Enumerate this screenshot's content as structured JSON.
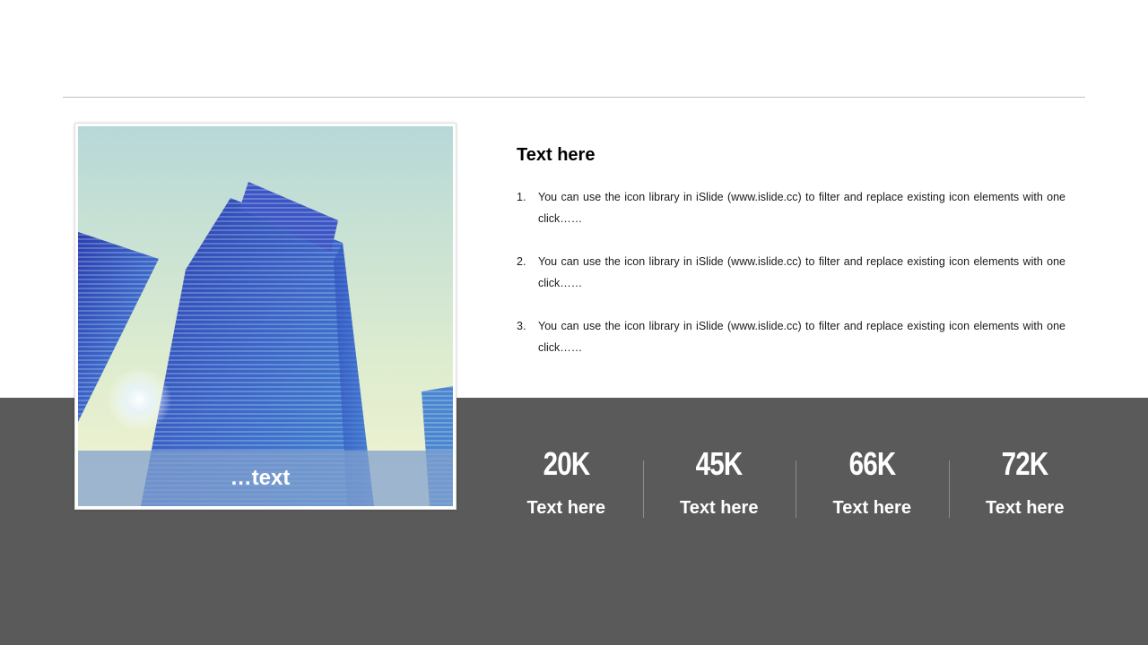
{
  "photo": {
    "caption": "…text"
  },
  "content": {
    "title": "Text here",
    "items": [
      {
        "number": "1.",
        "text": "You can use the icon library in iSlide  (www.islide.cc) to filter and replace existing icon elements with one click……"
      },
      {
        "number": "2.",
        "text": "You can use the icon library in iSlide  (www.islide.cc) to filter and replace existing icon elements with one click……"
      },
      {
        "number": "3.",
        "text": "You can use the icon library in iSlide  (www.islide.cc) to filter and replace existing icon elements with one click……"
      }
    ]
  },
  "stats": [
    {
      "value": "20K",
      "label": "Text here"
    },
    {
      "value": "45K",
      "label": "Text here"
    },
    {
      "value": "66K",
      "label": "Text here"
    },
    {
      "value": "72K",
      "label": "Text here"
    }
  ],
  "colors": {
    "band": "#5a5a5a",
    "rule": "#bfbfbf",
    "caption_bar": "#82a0cd"
  }
}
